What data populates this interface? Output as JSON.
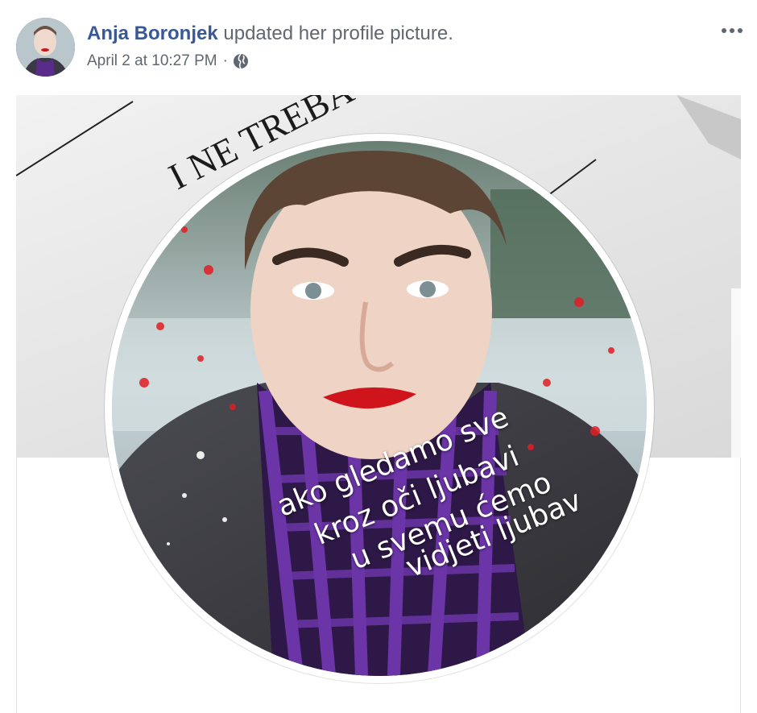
{
  "post": {
    "author": "Anja Boronjek",
    "action": "updated her profile picture.",
    "timestamp": "April 2 at 10:27 PM",
    "separator": "·",
    "audience_icon": "globe-icon",
    "more_icon": "more-options-icon"
  },
  "photo": {
    "cover_text": "I NE TREBA DA TUMESE",
    "overlay_lines": [
      "ako gledamo sve",
      "kroz oči ljubavi",
      "u svemu ćemo",
      "vidjeti ljubav"
    ]
  },
  "colors": {
    "link": "#385898",
    "meta": "#606770",
    "scarf": "#5a2b8a",
    "lips": "#d0141c"
  }
}
